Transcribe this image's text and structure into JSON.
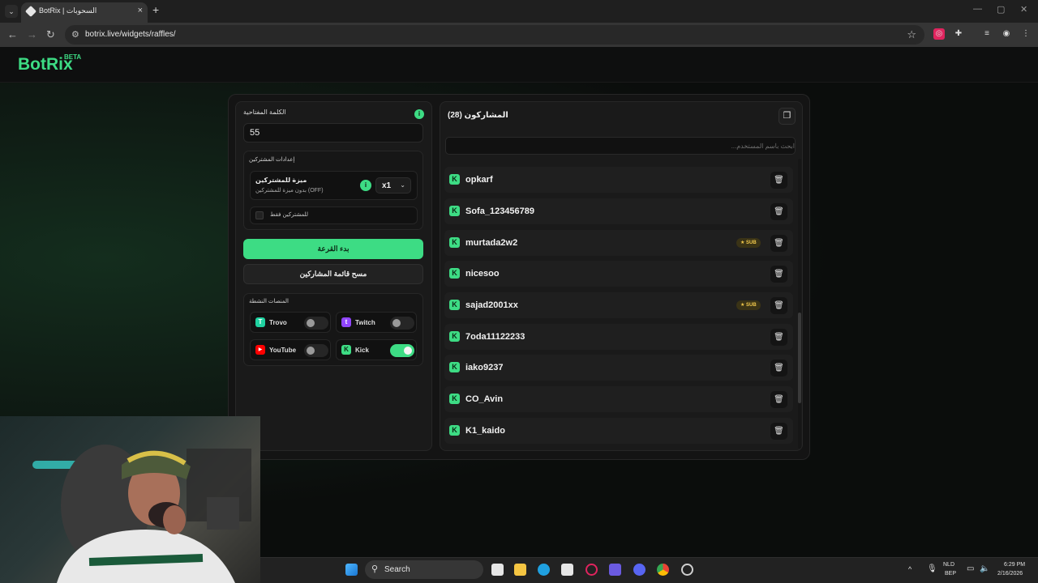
{
  "browser": {
    "tab_title": "BotRix | السحوبات",
    "tab_close": "×",
    "new_tab": "+",
    "url": "botrix.live/widgets/raffles/",
    "dropdown": "⌄",
    "controls": {
      "minimize": "—",
      "maximize": "▢",
      "close": "✕"
    }
  },
  "site": {
    "logo": "BotRix",
    "badge": "BETA"
  },
  "settings": {
    "keyword_label": "الكلمة المفتاحية",
    "keyword_value": "55",
    "info_glyph": "i",
    "subscriber_settings_title": "إعدادات المشتركين",
    "perk_title": "ميزة للمشتركين",
    "perk_subtitle": "بدون ميزة للمشتركين (OFF)",
    "multiplier": "x1",
    "subs_only_label": "للمشتركين فقط",
    "start_button": "بدء القرعة",
    "clear_button": "مسح قائمة المشاركين",
    "platforms_title": "المنصات النشطة",
    "platforms": [
      {
        "name": "Trovo",
        "icon": "trovo-icon",
        "enabled": false,
        "color": "#1fd1a0",
        "glyph": "T"
      },
      {
        "name": "Twitch",
        "icon": "twitch-icon",
        "enabled": false,
        "color": "#9146ff",
        "glyph": "t"
      },
      {
        "name": "YouTube",
        "icon": "youtube-icon",
        "enabled": false,
        "color": "#ff0000",
        "glyph": "▶"
      },
      {
        "name": "Kick",
        "icon": "kick-icon",
        "enabled": true,
        "color": "#3ddc84",
        "glyph": "K"
      }
    ]
  },
  "participants": {
    "title": "المشاركون (28)",
    "search_placeholder": "ابحث باسم المستخدم...",
    "sub_badge": "★ SUB",
    "list": [
      {
        "name": "opkarf",
        "sub": false
      },
      {
        "name": "Sofa_123456789",
        "sub": false
      },
      {
        "name": "murtada2w2",
        "sub": true
      },
      {
        "name": "nicesoo",
        "sub": false
      },
      {
        "name": "sajad2001xx",
        "sub": true
      },
      {
        "name": "7oda11122233",
        "sub": false
      },
      {
        "name": "iako9237",
        "sub": false
      },
      {
        "name": "CO_Avin",
        "sub": false
      },
      {
        "name": "K1_kaido",
        "sub": false
      }
    ]
  },
  "taskbar": {
    "search_label": "Search",
    "lang_1": "NLD",
    "lang_2": "BEP",
    "time": "6:29 PM",
    "date": "2/16/2026"
  },
  "colors": {
    "accent": "#3ddc84",
    "panel": "#1a1a1a",
    "background": "#0b0d0c"
  }
}
